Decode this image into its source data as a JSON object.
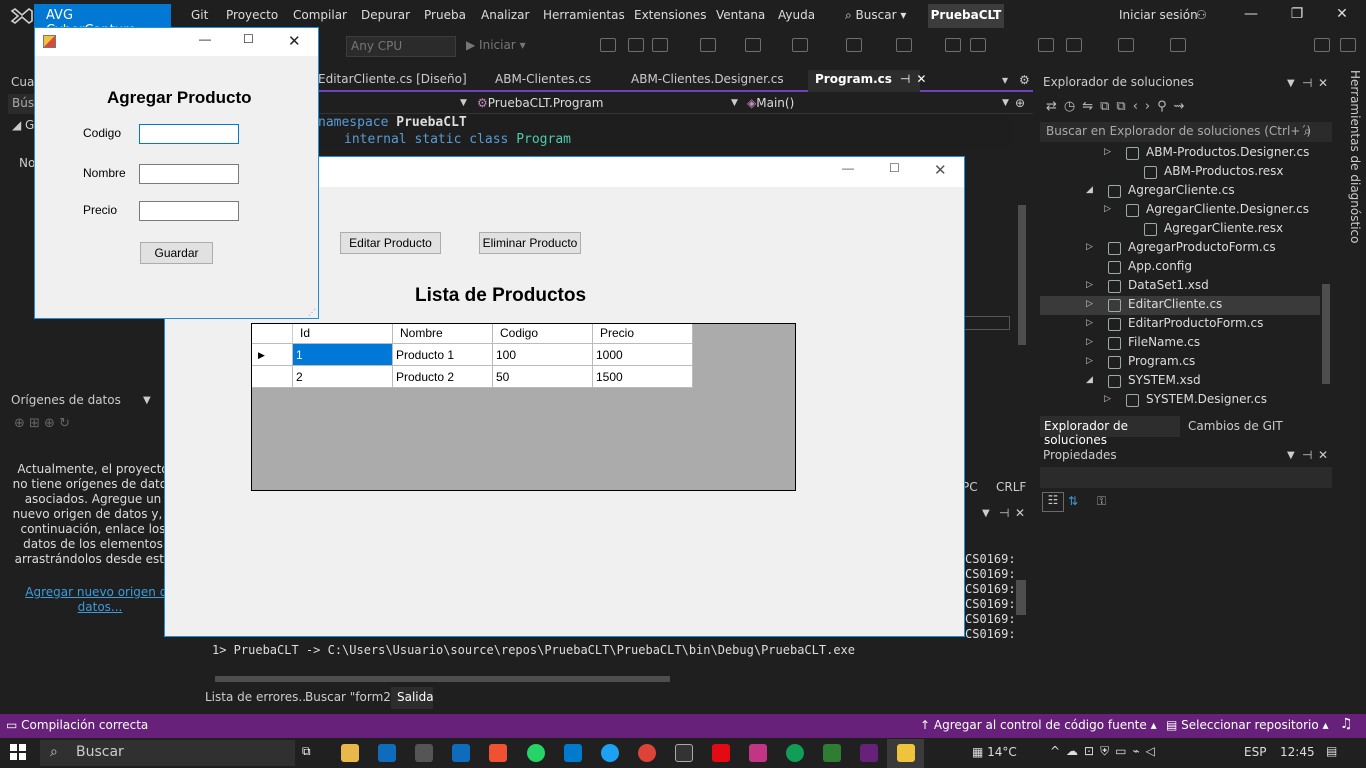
{
  "menubar": {
    "avg_title": "AVG CyberCapture",
    "items": [
      "Git",
      "Proyecto",
      "Compilar",
      "Depurar",
      "Prueba",
      "Analizar",
      "Herramientas",
      "Extensiones",
      "Ventana",
      "Ayuda"
    ],
    "search": "Buscar",
    "project": "PruebaCLT",
    "signin": "Iniciar sesión"
  },
  "toolbar": {
    "platform": "Any CPU",
    "start": "Iniciar"
  },
  "doc_tabs": {
    "tabs": [
      "EditarCliente.cs [Diseño]",
      "ABM-Clientes.cs",
      "ABM-Clientes.Designer.cs"
    ],
    "active": "Program.cs"
  },
  "code_nav": {
    "class": "PruebaCLT.Program",
    "member": "Main()"
  },
  "editor": {
    "line1_kw": "namespace",
    "line1_name": "PruebaCLT",
    "line2_kw": "internal static class",
    "line2_name": "Program"
  },
  "left_panel": {
    "top_tab": "Cua",
    "search": "Bús",
    "group": "G",
    "no_label": "No",
    "ds_title": "Orígenes de datos",
    "ds_text": "Actualmente, el proyecto no tiene orígenes de datos asociados. Agregue un nuevo origen de datos y, a continuación, enlace los datos de los elementos arrastrándolos desde esta",
    "ds_link": "Agregar nuevo origen de datos..."
  },
  "output": {
    "lines": [
      "CS0169:",
      "CS0169:",
      "CS0169:",
      "CS0169:",
      "CS0169:",
      "CS0169:"
    ],
    "last": "1>  PruebaCLT -> C:\\Users\\Usuario\\source\\repos\\PruebaCLT\\PruebaCLT\\bin\\Debug\\PruebaCLT.exe",
    "pc": "PC",
    "crlf": "CRLF",
    "tabs": [
      "Lista de errores...",
      "Buscar \"form2\"",
      "Salida"
    ]
  },
  "solution_explorer": {
    "title": "Explorador de soluciones",
    "search": "Buscar en Explorador de soluciones (Ctrl+´)",
    "items": [
      {
        "label": "ABM-Productos.Designer.cs",
        "expander": "▷"
      },
      {
        "label": "ABM-Productos.resx",
        "expander": ""
      },
      {
        "label": "AgregarCliente.cs",
        "expander": "◢"
      },
      {
        "label": "AgregarCliente.Designer.cs",
        "expander": "▷"
      },
      {
        "label": "AgregarCliente.resx",
        "expander": ""
      },
      {
        "label": "AgregarProductoForm.cs",
        "expander": "▷"
      },
      {
        "label": "App.config",
        "expander": ""
      },
      {
        "label": "DataSet1.xsd",
        "expander": "▷"
      },
      {
        "label": "EditarCliente.cs",
        "expander": "▷"
      },
      {
        "label": "EditarProductoForm.cs",
        "expander": "▷"
      },
      {
        "label": "FileName.cs",
        "expander": "▷"
      },
      {
        "label": "Program.cs",
        "expander": "▷"
      },
      {
        "label": "SYSTEM.xsd",
        "expander": "◢"
      },
      {
        "label": "SYSTEM.Designer.cs",
        "expander": "▷"
      }
    ],
    "tabs": [
      "Explorador de soluciones",
      "Cambios de GIT"
    ],
    "diag": "Herramientas de diagnóstico"
  },
  "properties": {
    "title": "Propiedades"
  },
  "status": {
    "left": "Compilación correcta",
    "add_source": "Agregar al control de código fuente",
    "repo": "Seleccionar repositorio"
  },
  "taskbar": {
    "search": "Buscar",
    "temp": "14°C",
    "lang": "ESP",
    "time": "12:45"
  },
  "lista_form": {
    "edit_btn": "Editar Producto",
    "delete_btn": "Eliminar Producto",
    "title": "Lista de Productos",
    "columns": [
      "Id",
      "Nombre",
      "Codigo",
      "Precio"
    ],
    "rows": [
      [
        "1",
        "Producto 1",
        "100",
        "1000"
      ],
      [
        "2",
        "Producto 2",
        "50",
        "1500"
      ]
    ]
  },
  "agregar_form": {
    "title": "Agregar Producto",
    "labels": [
      "Codigo",
      "Nombre",
      "Precio"
    ],
    "save": "Guardar"
  },
  "colors": {
    "accent": "#68217a",
    "avg": "#0078d4",
    "link": "#3b9cdb"
  }
}
